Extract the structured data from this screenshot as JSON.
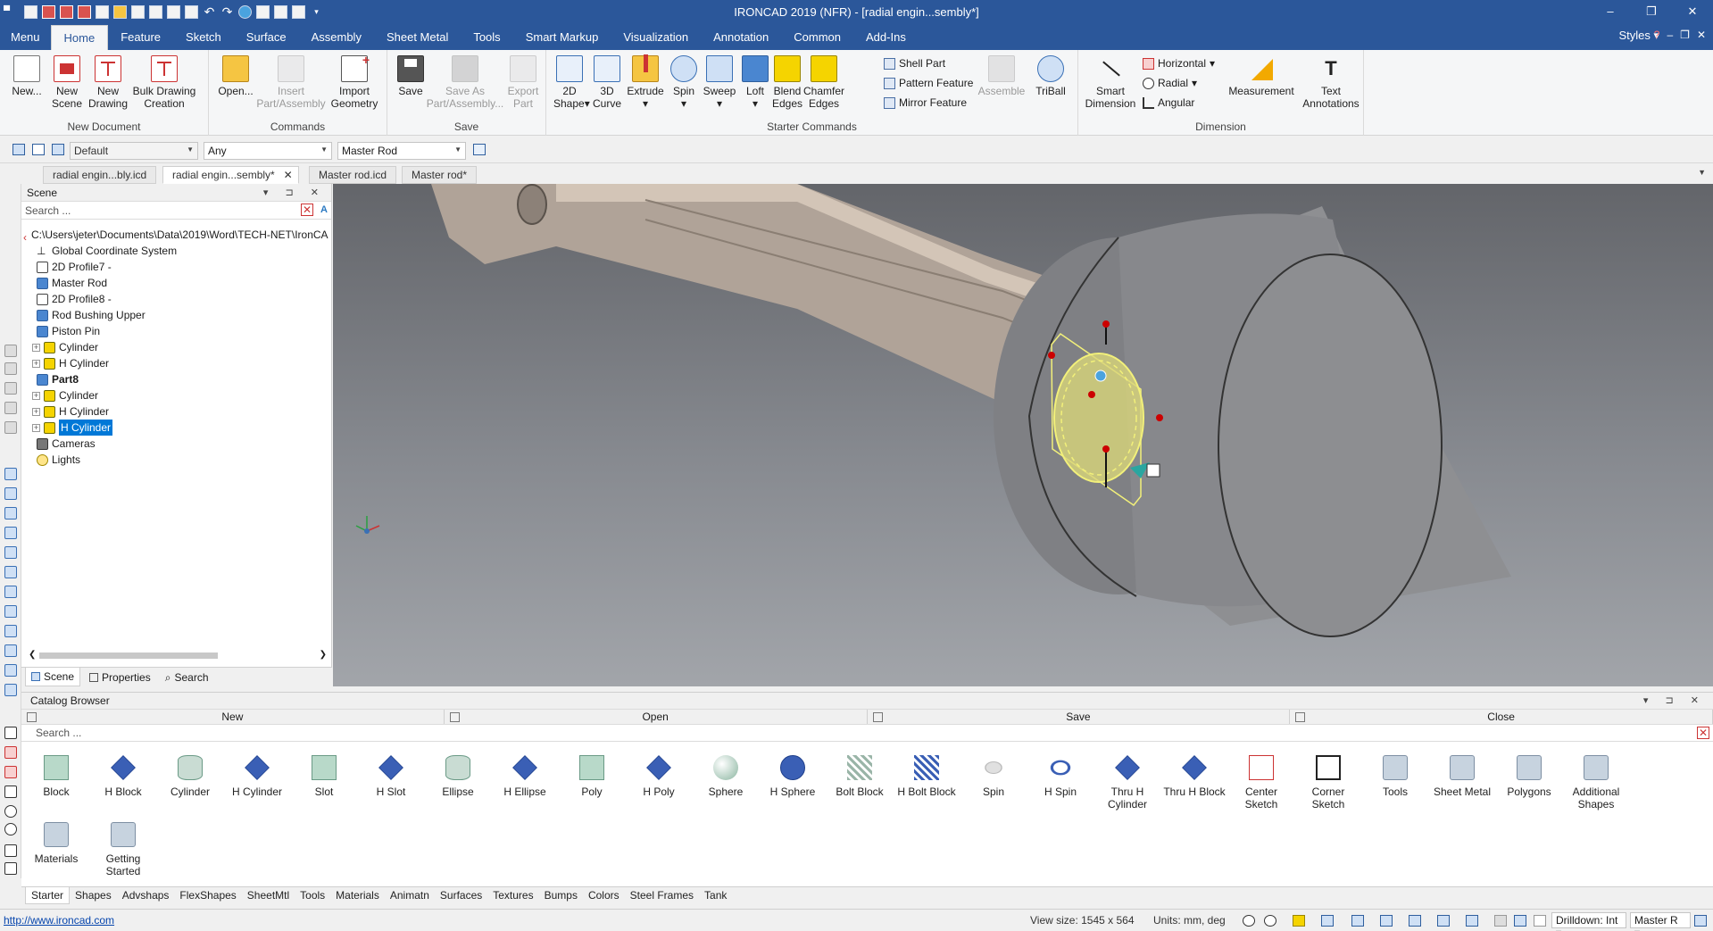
{
  "window": {
    "title": "IRONCAD 2019 (NFR) - [radial engin...sembly*]",
    "controls": [
      "–",
      "❐",
      "✕"
    ]
  },
  "menu_tabs": [
    "Menu",
    "Home",
    "Feature",
    "Sketch",
    "Surface",
    "Assembly",
    "Sheet Metal",
    "Tools",
    "Smart Markup",
    "Visualization",
    "Annotation",
    "Common",
    "Add-Ins"
  ],
  "styles_label": "Styles",
  "ribbon": {
    "groups": {
      "new_document": "New Document",
      "commands": "Commands",
      "save": "Save",
      "starter_commands": "Starter Commands",
      "dimension": "Dimension"
    },
    "buttons": {
      "new": "New...",
      "new_scene": [
        "New",
        "Scene"
      ],
      "new_drawing": [
        "New",
        "Drawing"
      ],
      "bulk_drawing": [
        "Bulk Drawing",
        "Creation"
      ],
      "open": "Open...",
      "insert_part": [
        "Insert",
        "Part/Assembly"
      ],
      "import_geometry": [
        "Import",
        "Geometry"
      ],
      "save": "Save",
      "save_as": [
        "Save As",
        "Part/Assembly..."
      ],
      "export_part": [
        "Export",
        "Part"
      ],
      "shape_2d": [
        "2D",
        "Shape"
      ],
      "curve_3d": [
        "3D",
        "Curve"
      ],
      "extrude": "Extrude",
      "spin": "Spin",
      "sweep": "Sweep",
      "loft": "Loft",
      "blend_edges": [
        "Blend",
        "Edges"
      ],
      "chamfer_edges": [
        "Chamfer",
        "Edges"
      ],
      "shell_part": "Shell Part",
      "pattern_feature": "Pattern Feature",
      "mirror_feature": "Mirror Feature",
      "assemble": "Assemble",
      "triball": "TriBall",
      "smart_dimension": [
        "Smart",
        "Dimension"
      ],
      "horizontal": "Horizontal",
      "radial": "Radial",
      "angular": "Angular",
      "measurement": "Measurement",
      "text_annotations": [
        "Text",
        "Annotations"
      ]
    }
  },
  "toolbar": {
    "style_combo": "Default",
    "filter_combo": "Any",
    "part_combo": "Master Rod"
  },
  "doc_tabs": [
    "radial engin...bly.icd",
    "radial engin...sembly*",
    "Master rod.icd",
    "Master rod*"
  ],
  "scene": {
    "title": "Scene",
    "search_placeholder": "Search ...",
    "tree": [
      {
        "label": "C:\\Users\\jeter\\Documents\\Data\\2019\\Word\\TECH-NET\\IronCA",
        "icon": "path",
        "indent": 0
      },
      {
        "label": "Global Coordinate System",
        "icon": "coord",
        "indent": 1
      },
      {
        "label": "2D Profile7 -",
        "icon": "prof",
        "indent": 1
      },
      {
        "label": "Master Rod",
        "icon": "part",
        "indent": 1
      },
      {
        "label": "2D Profile8 -",
        "icon": "prof",
        "indent": 1
      },
      {
        "label": "Rod Bushing Upper",
        "icon": "part",
        "indent": 1
      },
      {
        "label": "Piston Pin",
        "icon": "part",
        "indent": 1
      },
      {
        "label": "Cylinder",
        "icon": "feat",
        "indent": 2
      },
      {
        "label": "H Cylinder",
        "icon": "feat",
        "indent": 2
      },
      {
        "label": "Part8",
        "icon": "part",
        "indent": 1,
        "bold": true
      },
      {
        "label": "Cylinder",
        "icon": "feat",
        "indent": 2
      },
      {
        "label": "H Cylinder",
        "icon": "feat",
        "indent": 2
      },
      {
        "label": "H Cylinder",
        "icon": "feat",
        "indent": 2,
        "selected": true
      },
      {
        "label": "Cameras",
        "icon": "cam",
        "indent": 1
      },
      {
        "label": "Lights",
        "icon": "light",
        "indent": 1
      }
    ],
    "tabs": [
      "Scene",
      "Properties",
      "Search"
    ]
  },
  "catalog": {
    "title": "Catalog Browser",
    "actions": [
      "New",
      "Open",
      "Save",
      "Close"
    ],
    "search_placeholder": "Search ...",
    "items_row1": [
      {
        "label": "Block",
        "shape": "block"
      },
      {
        "label": "H Block",
        "shape": "hblock"
      },
      {
        "label": "Cylinder",
        "shape": "cyl"
      },
      {
        "label": "H Cylinder",
        "shape": "hcyl"
      },
      {
        "label": "Slot",
        "shape": "block"
      },
      {
        "label": "H Slot",
        "shape": "hblock"
      },
      {
        "label": "Ellipse",
        "shape": "cyl"
      },
      {
        "label": "H Ellipse",
        "shape": "hcyl"
      },
      {
        "label": "Poly",
        "shape": "block"
      },
      {
        "label": "H Poly",
        "shape": "hblock"
      },
      {
        "label": "Sphere",
        "shape": "sphere"
      },
      {
        "label": "H Sphere",
        "shape": "hsphere"
      },
      {
        "label": "Bolt Block",
        "shape": "bolt"
      },
      {
        "label": "H Bolt Block",
        "shape": "hbolt"
      },
      {
        "label": "Spin",
        "shape": "spin"
      },
      {
        "label": "H Spin",
        "shape": "hspin"
      },
      {
        "label": "Thru H Cylinder",
        "shape": "hcyl"
      },
      {
        "label": "Thru H Block",
        "shape": "hblock"
      },
      {
        "label": "Center Sketch",
        "shape": "sketch"
      },
      {
        "label": "Corner Sketch",
        "shape": "sketch2"
      },
      {
        "label": "Tools",
        "shape": "folder"
      },
      {
        "label": "Sheet Metal",
        "shape": "folder"
      },
      {
        "label": "Polygons",
        "shape": "folder"
      },
      {
        "label": "Additional Shapes",
        "shape": "folder"
      }
    ],
    "items_row2": [
      {
        "label": "Materials",
        "shape": "folder"
      },
      {
        "label": "Getting Started",
        "shape": "folder"
      }
    ],
    "tabs": [
      "Starter",
      "Shapes",
      "Advshaps",
      "FlexShapes",
      "SheetMtl",
      "Tools",
      "Materials",
      "Animatn",
      "Surfaces",
      "Textures",
      "Bumps",
      "Colors",
      "Steel Frames",
      "Tank"
    ]
  },
  "status": {
    "url": "http://www.ironcad.com",
    "view_size": "View size: 1545 x  564",
    "units": "Units: mm, deg",
    "drilldown": "Drilldown: Int",
    "part_combo": "Master R"
  },
  "colors": {
    "title_bar": "#2b579a",
    "ribbon": "#f5f6f7",
    "selection": "#0078d7",
    "viewport_top": "#63656a",
    "viewport_bottom": "#a2a5aa",
    "highlight_yellow": "#f2f07a"
  }
}
